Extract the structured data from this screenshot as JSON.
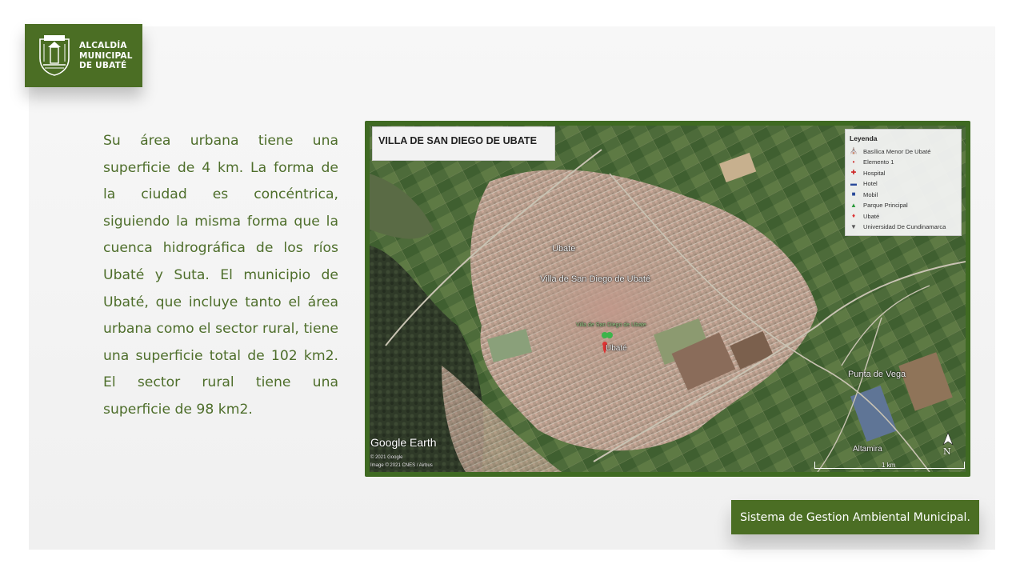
{
  "logo": {
    "line1": "ALCALDÍA",
    "line2": "MUNICIPAL",
    "line3": "DE UBATÉ",
    "shield_top_text": "UBATE",
    "icon": "municipal-shield-icon",
    "color": "#4b6e24"
  },
  "body": {
    "paragraph": "Su área urbana tiene una superficie de 4 km. La forma de la ciudad es concéntrica, siguiendo la misma forma que la cuenca hidrográfica de los ríos Ubaté y Suta. El municipio de Ubaté, que incluye tanto el área urbana como el sector rural, tiene una superficie total de 102 km2. El sector rural tiene una superficie de 98 km2.",
    "color": "#4e6e2b"
  },
  "map": {
    "title": "VILLA DE SAN DIEGO DE UBATE",
    "frame_color": "#3f6a22",
    "legend": {
      "title": "Leyenda",
      "items": [
        {
          "label": "Basílica Menor De Ubaté",
          "icon": "church-icon"
        },
        {
          "label": "Elemento 1",
          "icon": "dot-icon"
        },
        {
          "label": "Hospital",
          "icon": "hospital-icon"
        },
        {
          "label": "Hotel",
          "icon": "bed-icon"
        },
        {
          "label": "Mobil",
          "icon": "fuel-icon"
        },
        {
          "label": "Parque Principal",
          "icon": "tree-icon"
        },
        {
          "label": "Ubaté",
          "icon": "pin-icon"
        },
        {
          "label": "Universidad De Cundinamarca",
          "icon": "graduation-icon"
        }
      ]
    },
    "labels": {
      "ubate_top": "Ubate",
      "villa": "Villa de San Diego de Ubaté",
      "villa_small": "Villa de San Diego de Ubate",
      "ubate_pin": "Ubaté",
      "punta_de_vega": "Punta de Vega",
      "altamira": "Altamira"
    },
    "google_earth": "Google Earth",
    "credit1": "© 2021 Google",
    "credit2": "Image © 2021 CNES / Airbus",
    "scale": "1 km",
    "north": "N"
  },
  "footer": {
    "label": "Sistema de Gestion Ambiental Municipal."
  }
}
